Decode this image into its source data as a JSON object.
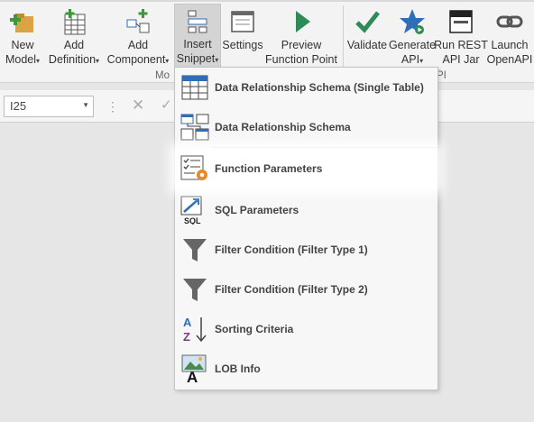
{
  "ribbon": {
    "buttons": [
      {
        "l1": "New",
        "l2": "Model"
      },
      {
        "l1": "Add",
        "l2": "Definition"
      },
      {
        "l1": "Add",
        "l2": "Component"
      },
      {
        "l1": "Insert",
        "l2": "Snippet"
      },
      {
        "l1": "Settings",
        "l2": ""
      },
      {
        "l1": "Preview",
        "l2": "Function Point"
      },
      {
        "l1": "Validate",
        "l2": ""
      },
      {
        "l1": "Generate",
        "l2": "API"
      },
      {
        "l1": "Run REST",
        "l2": "API Jar"
      },
      {
        "l1": "Launch",
        "l2": "OpenAPI"
      }
    ],
    "group_label_left": "Mo",
    "group_label_right": "PI",
    "caret": "▾"
  },
  "formula_bar": {
    "name_box_value": "I25",
    "separator": "⋮",
    "cancel_symbol": "✕",
    "ok_symbol": "✓"
  },
  "menu": {
    "items": [
      {
        "label": "Data Relationship Schema (Single Table)",
        "icon": "table-icon"
      },
      {
        "label": "Data Relationship Schema",
        "icon": "related-tables-icon"
      },
      {
        "label": "Function Parameters",
        "icon": "parameters-gear-icon"
      },
      {
        "label": "SQL Parameters",
        "icon": "sql-icon"
      },
      {
        "label": "Filter Condition (Filter Type 1)",
        "icon": "filter-icon"
      },
      {
        "label": "Filter Condition (Filter Type 2)",
        "icon": "filter-icon"
      },
      {
        "label": "Sorting Criteria",
        "icon": "sort-az-icon"
      },
      {
        "label": "LOB Info",
        "icon": "lob-image-icon"
      }
    ],
    "sql_icon_text": "SQL",
    "sort_icon_letters": [
      "A",
      "Z"
    ],
    "lob_icon_letter": "A"
  },
  "colors": {
    "accent_green": "#217346",
    "icon_blue": "#2f6db5",
    "icon_orange": "#e8882b"
  }
}
